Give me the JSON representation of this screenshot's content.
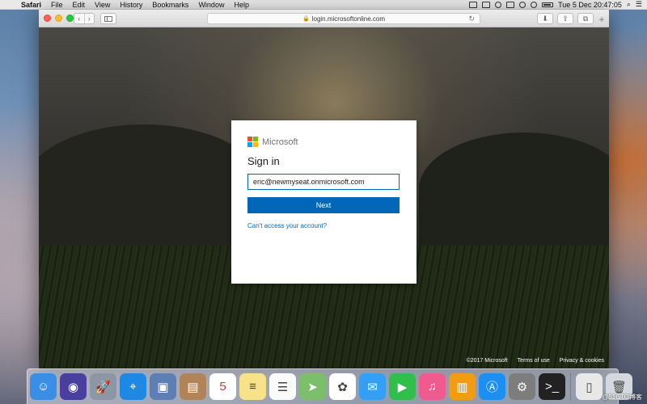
{
  "menubar": {
    "app_name": "Safari",
    "items": [
      "File",
      "Edit",
      "View",
      "History",
      "Bookmarks",
      "Window",
      "Help"
    ],
    "clock": "Tue 5 Dec  20:47:05"
  },
  "browser": {
    "url": "login.microsoftonline.com"
  },
  "signin": {
    "brand": "Microsoft",
    "title": "Sign in",
    "email_value": "eric@newmyseat.onmicrosoft.com",
    "next_label": "Next",
    "help_link": "Can't access your account?",
    "colors": {
      "primary": "#0067b8"
    }
  },
  "footer": {
    "copyright": "©2017 Microsoft",
    "terms": "Terms of use",
    "privacy": "Privacy & cookies"
  },
  "dock": {
    "apps": [
      {
        "name": "finder-icon",
        "bg": "#3a8ee6",
        "glyph": "☺"
      },
      {
        "name": "siri-icon",
        "bg": "#4a3f9e",
        "glyph": "◉"
      },
      {
        "name": "launchpad-icon",
        "bg": "#8c96a5",
        "glyph": "🚀"
      },
      {
        "name": "safari-icon",
        "bg": "#1e88e5",
        "glyph": "⌖"
      },
      {
        "name": "photo-preview-icon",
        "bg": "#5d7fb3",
        "glyph": "▣"
      },
      {
        "name": "notebook-icon",
        "bg": "#b08457",
        "glyph": "▤"
      },
      {
        "name": "calendar-icon",
        "bg": "#ffffff",
        "glyph": "5"
      },
      {
        "name": "notes-icon",
        "bg": "#f7e28a",
        "glyph": "≡"
      },
      {
        "name": "reminders-icon",
        "bg": "#fafafa",
        "glyph": "☰"
      },
      {
        "name": "maps-icon",
        "bg": "#7bbf6a",
        "glyph": "➤"
      },
      {
        "name": "photos-icon",
        "bg": "#ffffff",
        "glyph": "✿"
      },
      {
        "name": "messages-icon",
        "bg": "#34a0f5",
        "glyph": "✉"
      },
      {
        "name": "facetime-icon",
        "bg": "#2fbf4a",
        "glyph": "▶"
      },
      {
        "name": "itunes-icon",
        "bg": "#f15a8e",
        "glyph": "♫"
      },
      {
        "name": "ibooks-icon",
        "bg": "#f39c12",
        "glyph": "▥"
      },
      {
        "name": "app-store-icon",
        "bg": "#1b8ff2",
        "glyph": "Ⓐ"
      },
      {
        "name": "system-preferences-icon",
        "bg": "#7d7d7d",
        "glyph": "⚙"
      },
      {
        "name": "terminal-icon",
        "bg": "#222222",
        "glyph": ">_"
      },
      {
        "name": "document-icon",
        "bg": "#e8e8e8",
        "glyph": "▯"
      },
      {
        "name": "trash-icon",
        "bg": "#d5d9df",
        "glyph": "🗑"
      }
    ],
    "separator_after": 17
  },
  "watermark": "@51CTO博客"
}
